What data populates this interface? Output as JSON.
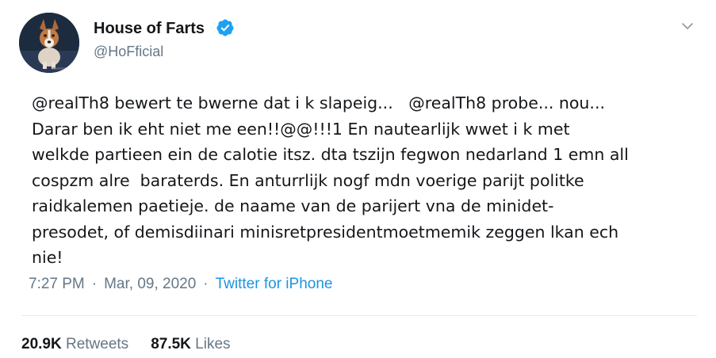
{
  "user": {
    "display_name": "House of Farts",
    "handle": "@HoFficial",
    "verified": true
  },
  "tweet": {
    "text": "@realTh8 bewert te bwerne dat i k slapeig...   @realTh8 probe... nou...\nDarar ben ik eht niet me een!!@@!!!1 En nautearlijk wwet i k met\nwelkde partieen ein de calotie itsz. dta tszijn fegwon nedarland 1 emn all\ncospzm alre  baraterds. En anturrlijk nogf mdn voerige parijt politke\nraidkalemen paetieje. de naame van de parijert vna de minidet-\npresodet, of demisdiinari minisretpresidentmoetmemik zeggen lkan ech\nnie!"
  },
  "meta": {
    "time": "7:27 PM",
    "separator": "·",
    "date": "Mar, 09, 2020",
    "source": "Twitter for iPhone"
  },
  "stats": {
    "retweets_count": "20.9K",
    "retweets_label": "Retweets",
    "likes_count": "87.5K",
    "likes_label": "Likes"
  },
  "icons": {
    "verified": "verified-badge-icon",
    "caret": "chevron-down-icon"
  },
  "colors": {
    "text": "#14171a",
    "secondary": "#657786",
    "link": "#1b95e0",
    "verified": "#1da1f2",
    "divider": "#e6ecf0"
  }
}
